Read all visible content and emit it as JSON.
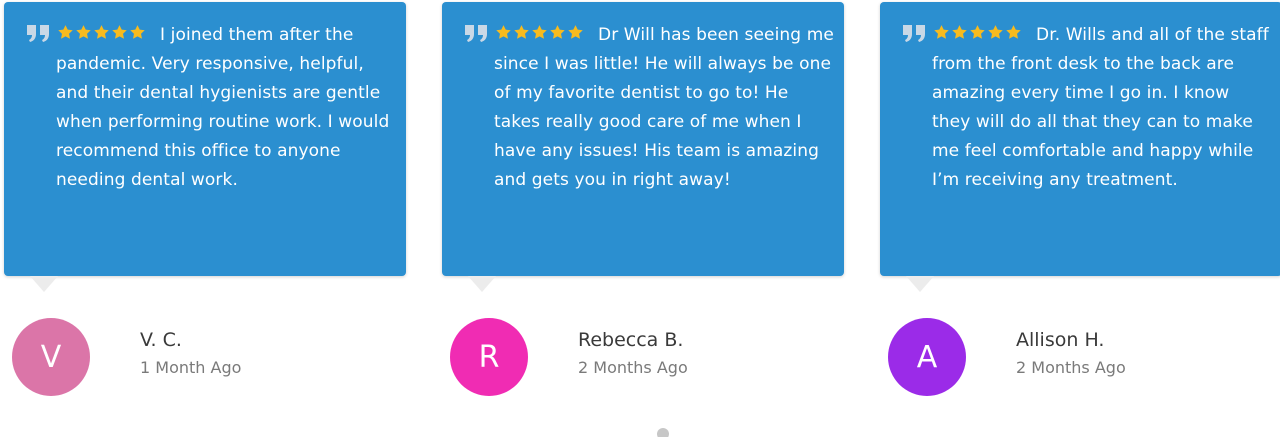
{
  "reviews": [
    {
      "rating": 5,
      "text": "I joined them after the pandemic. Very responsive, helpful, and their dental hygienists are gentle when performing routine work. I would recommend this office to anyone needing dental work.",
      "initial": "V",
      "name": "V. C.",
      "time_ago": "1 Month Ago",
      "avatar_color": "#db75a8"
    },
    {
      "rating": 5,
      "text": "Dr Will has been seeing me since I was little! He will always be one of my favorite dentist to go to! He takes really good care of me when I have any issues! His team is amazing and gets you in right away!",
      "initial": "R",
      "name": "Rebecca B.",
      "time_ago": "2 Months Ago",
      "avatar_color": "#f02cb3"
    },
    {
      "rating": 5,
      "text": "Dr. Wills and all of the staff from the front desk to the back are amazing every time I go in. I know they will do all that they can to make me feel comfortable and happy while I’m receiving any treatment.",
      "initial": "A",
      "name": "Allison H.",
      "time_ago": "2 Months Ago",
      "avatar_color": "#9b2be8"
    }
  ],
  "colors": {
    "card_background": "#2b8fd0",
    "star": "#f7bb1e",
    "quote_icon": "#c9d8e6"
  },
  "icons": {
    "quote": "quote-icon",
    "star": "star-icon"
  }
}
